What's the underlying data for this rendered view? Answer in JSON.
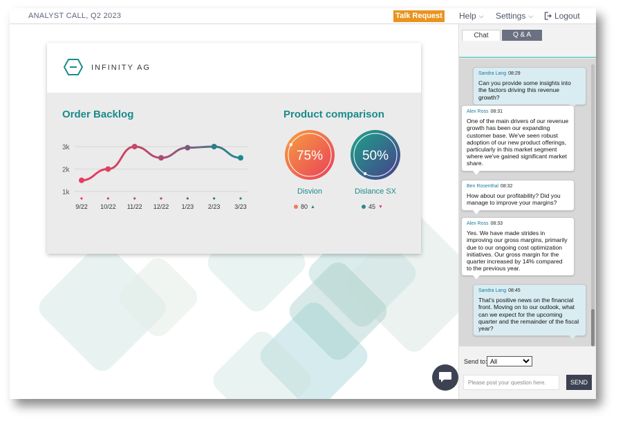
{
  "header": {
    "event_title": "ANALYST CALL, Q2 2023",
    "talk_request": "Talk Request",
    "help": "Help",
    "settings": "Settings",
    "logout": "Logout"
  },
  "slide": {
    "company": "INFINITY AG",
    "order_backlog_title": "Order Backlog",
    "product_comparison_title": "Product comparison",
    "products": [
      {
        "name": "Disvion",
        "percent": "75%",
        "fraction": 0.75,
        "value": "80",
        "trend": "up",
        "dot_color": "#f07a5a"
      },
      {
        "name": "Dislance SX",
        "percent": "50%",
        "fraction": 0.5,
        "value": "45",
        "trend": "down",
        "dot_color": "#2a8a8a"
      }
    ]
  },
  "chart_data": {
    "type": "line",
    "title": "Order Backlog",
    "categories": [
      "9/22",
      "10/22",
      "11/22",
      "12/22",
      "1/23",
      "2/23",
      "3/23"
    ],
    "y_ticks": [
      "3k",
      "2k",
      "1k"
    ],
    "series": [
      {
        "values": [
          1500,
          2000,
          3000,
          2500,
          2950,
          3000,
          2500
        ]
      }
    ],
    "ylim": [
      1000,
      3000
    ],
    "grid": true
  },
  "sidebar": {
    "tabs": [
      "Chat",
      "Q & A"
    ],
    "messages": [
      {
        "who": "Sandra Lang",
        "time": "08:29",
        "text": "Can you provide some insights into the factors driving this revenue growth?"
      },
      {
        "who": "Alex Ross",
        "time": "08:31",
        "text": "One of the main drivers of our revenue growth has been our expanding customer base. We've seen robust adoption of our new product offerings, particularly in this market segment where we've gained significant market share."
      },
      {
        "who": "Ben Rosenthal",
        "time": "08:32",
        "text": "How about our profitability? Did you manage to improve your margins?"
      },
      {
        "who": "Alex Ross",
        "time": "08:33",
        "text": "Yes. We have made strides in improving our gross margins, primarily due to our ongoing cost optimization initiatives. Our gross margin for the quarter increased by 14% compared to the previous year."
      },
      {
        "who": "Sandra Lang",
        "time": "08:45",
        "text": "That's positive news on the financial front. Moving on to our outlook, what can we expect for the upcoming quarter and the remainder of the fiscal year?"
      }
    ],
    "send_to_label": "Send to:",
    "send_to_value": "All",
    "input_placeholder": "Please post your question here.",
    "send_label": "SEND"
  }
}
